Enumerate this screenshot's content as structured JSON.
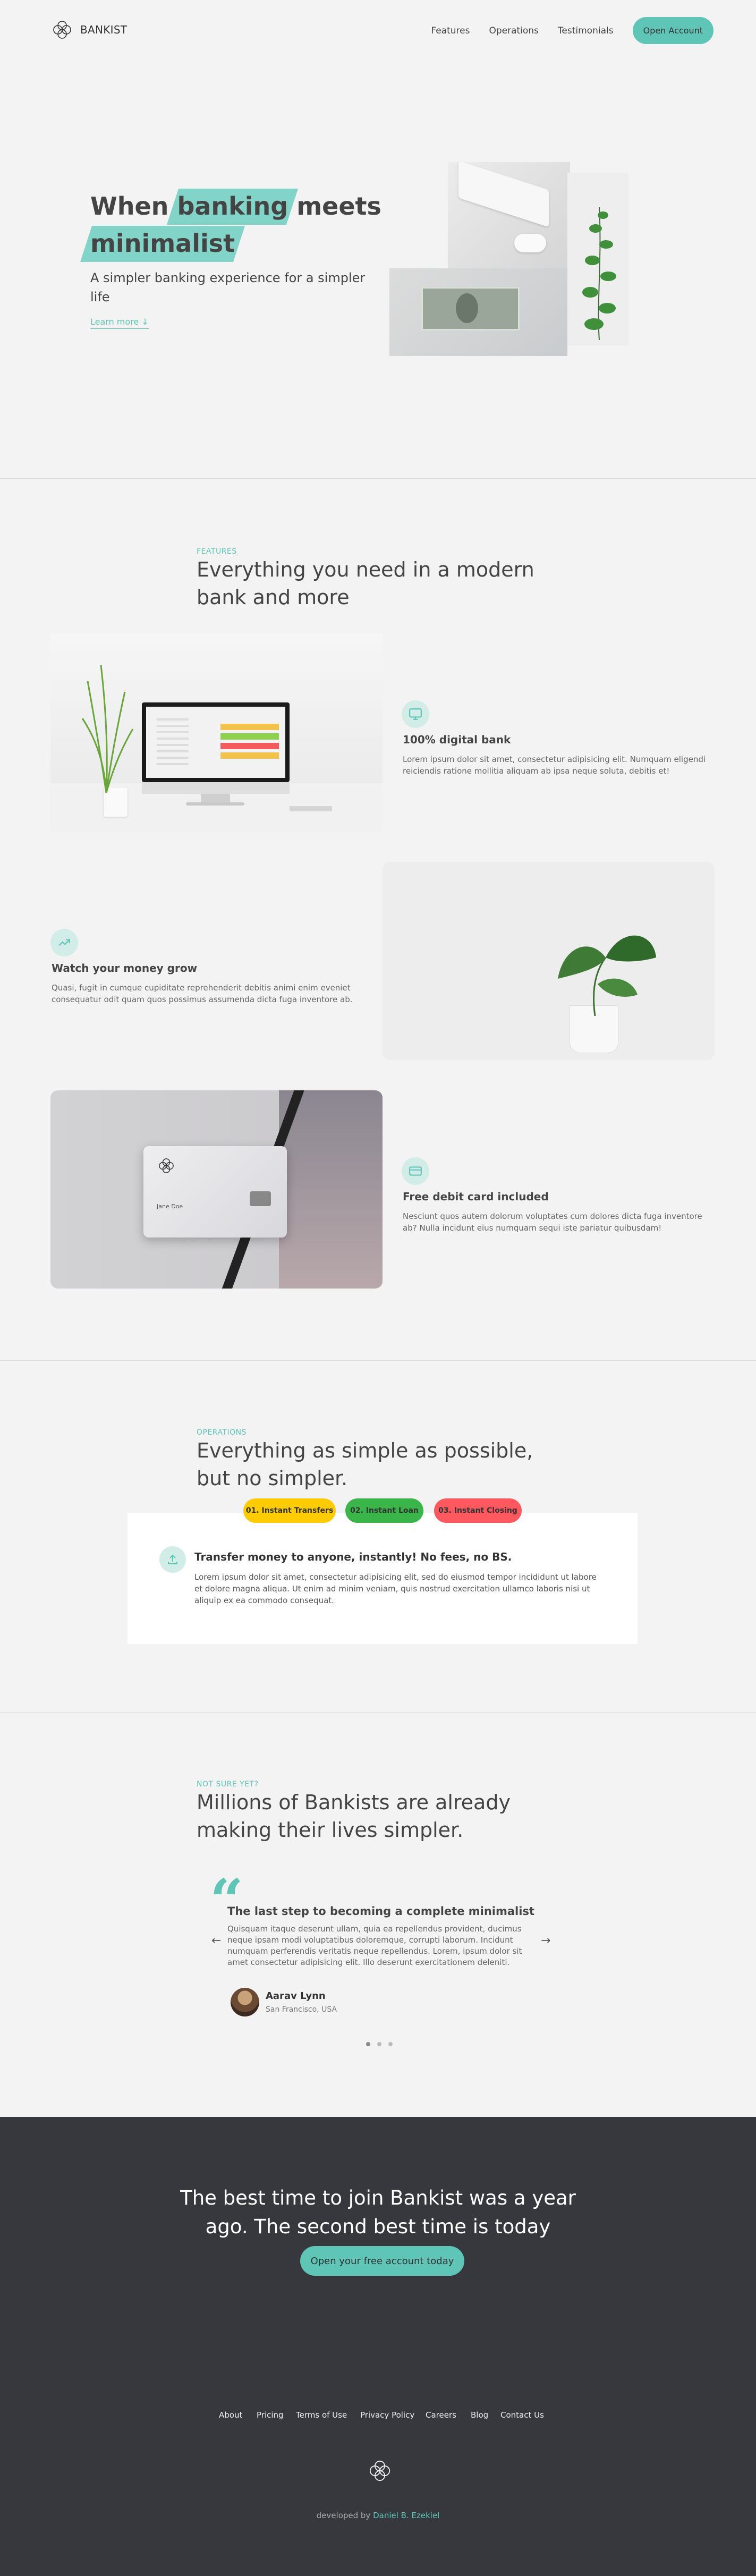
{
  "nav": {
    "logo_text": "BANKIST",
    "links": [
      "Features",
      "Operations",
      "Testimonials"
    ],
    "cta": "Open Account"
  },
  "hero": {
    "title_pre": "When ",
    "title_hl1": "banking",
    "title_mid": " meets ",
    "title_hl2": "minimalist",
    "subtitle": "A simpler banking experience for a simpler life",
    "link": "Learn more ↓"
  },
  "features": {
    "label": "Features",
    "title": "Everything you need in a modern bank and more",
    "items": [
      {
        "title": "100% digital bank",
        "text": "Lorem ipsum dolor sit amet, consectetur adipisicing elit. Numquam eligendi reiciendis ratione mollitia aliquam ab ipsa neque soluta, debitis et!",
        "icon": "monitor-icon"
      },
      {
        "title": "Watch your money grow",
        "text": "Quasi, fugit in cumque cupiditate reprehenderit debitis animi enim eveniet consequatur odit quam quos possimus assumenda dicta fuga inventore ab.",
        "icon": "trending-up-icon"
      },
      {
        "title": "Free debit card included",
        "text": "Nesciunt quos autem dolorum voluptates cum dolores dicta fuga inventore ab? Nulla incidunt eius numquam sequi iste pariatur quibusdam!",
        "icon": "credit-card-icon"
      }
    ],
    "card_name": "Jane Doe"
  },
  "operations": {
    "label": "Operations",
    "title": "Everything as simple as possible, but no simpler.",
    "tabs": [
      "01. Instant Transfers",
      "02. Instant Loan",
      "03. Instant Closing"
    ],
    "tab_colors": [
      "#ffcb03",
      "#39b54a",
      "#ff585f"
    ],
    "content_title": "Transfer money to anyone, instantly! No fees, no BS.",
    "content_text": "Lorem ipsum dolor sit amet, consectetur adipisicing elit, sed do eiusmod tempor incididunt ut labore et dolore magna aliqua. Ut enim ad minim veniam, quis nostrud exercitation ullamco laboris nisi ut aliquip ex ea commodo consequat."
  },
  "testimonials": {
    "label": "Not sure yet?",
    "title": "Millions of Bankists are already making their lives simpler.",
    "quote_title": "The last step to becoming a complete minimalist",
    "quote_text": "Quisquam itaque deserunt ullam, quia ea repellendus provident, ducimus neque ipsam modi voluptatibus doloremque, corrupti laborum. Incidunt numquam perferendis veritatis neque repellendus. Lorem, ipsum dolor sit amet consectetur adipisicing elit. Illo deserunt exercitationem deleniti.",
    "author": "Aarav Lynn",
    "location": "San Francisco, USA",
    "prev": "←",
    "next": "→",
    "quote_mark": "“"
  },
  "cta": {
    "title_line1": "The best time to join Bankist was a year",
    "title_line2": "ago. The second best time is today",
    "button": "Open your free account today"
  },
  "footer": {
    "links": [
      "About",
      "Pricing",
      "Terms of Use",
      "Privacy Policy",
      "Careers",
      "Blog",
      "Contact Us"
    ],
    "credit_pre": "developed by ",
    "credit_name": "Daniel B. Ezekiel"
  },
  "colors": {
    "accent": "#5ec5b7",
    "dark": "#37383d",
    "bg": "#f3f3f3"
  }
}
